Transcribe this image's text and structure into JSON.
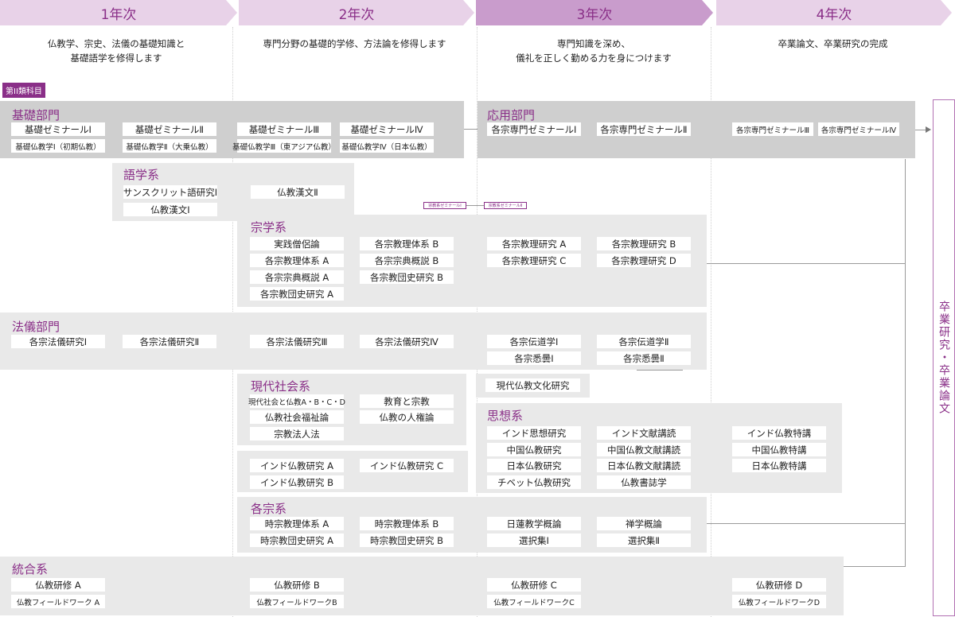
{
  "years": [
    "1年次",
    "2年次",
    "3年次",
    "4年次"
  ],
  "descriptions": {
    "y1": [
      "仏教学、宗史、法儀の基礎知識と",
      "基礎語学を修得します"
    ],
    "y2": [
      "専門分野の基礎的学修、方法論を修得します"
    ],
    "y3": [
      "専門知識を深め、",
      "儀礼を正しく勤める力を身につけます"
    ],
    "y4": [
      "卒業論文、卒業研究の完成"
    ]
  },
  "category_tag": "第II類科目",
  "kiso": {
    "title": "基礎部門",
    "courses": [
      "基礎ゼミナールⅠ",
      "基礎ゼミナールⅡ",
      "基礎ゼミナールⅢ",
      "基礎ゼミナールⅣ",
      "基礎仏教学Ⅰ（初期仏教）",
      "基礎仏教学Ⅱ（大乗仏教）",
      "基礎仏教学Ⅲ（東アジア仏教）",
      "基礎仏教学Ⅳ（日本仏教）"
    ]
  },
  "oyo": {
    "title": "応用部門",
    "courses": [
      "各宗専門ゼミナールⅠ",
      "各宗専門ゼミナールⅡ",
      "各宗専門ゼミナールⅢ",
      "各宗専門ゼミナールⅣ"
    ]
  },
  "gogaku": {
    "title": "語学系",
    "courses": [
      "サンスクリット語研究Ⅰ",
      "仏教漢文Ⅱ",
      "仏教漢文Ⅰ"
    ]
  },
  "mini_seminars": [
    "宗教系ゼミナールⅠ",
    "宗教系ゼミナールⅡ"
  ],
  "shugaku": {
    "title": "宗学系",
    "courses": [
      "実践僧侶論",
      "各宗教理体系 B",
      "各宗教理体系 A",
      "各宗宗典概説 B",
      "各宗宗典概説 A",
      "各宗教団史研究 B",
      "各宗教団史研究 A",
      "各宗教理研究 A",
      "各宗教理研究 B",
      "各宗教理研究 C",
      "各宗教理研究 D"
    ]
  },
  "hogi": {
    "title": "法儀部門",
    "courses": [
      "各宗法儀研究Ⅰ",
      "各宗法儀研究Ⅱ",
      "各宗法儀研究Ⅲ",
      "各宗法儀研究Ⅳ",
      "各宗伝道学Ⅰ",
      "各宗伝道学Ⅱ",
      "各宗悉曇Ⅰ",
      "各宗悉曇Ⅱ"
    ]
  },
  "gendai": {
    "title": "現代社会系",
    "courses": [
      "現代社会と仏教A・B・C・D",
      "教育と宗教",
      "仏教社会福祉論",
      "仏教の人権論",
      "宗教法人法",
      "現代仏教文化研究"
    ]
  },
  "shiso": {
    "title": "思想系",
    "courses": [
      "インド思想研究",
      "インド文献講読",
      "インド仏教特講",
      "中国仏教研究",
      "中国仏教文献講読",
      "中国仏教特講",
      "日本仏教研究",
      "日本仏教文献講読",
      "日本仏教特講",
      "チベット仏教研究",
      "仏教書誌学"
    ]
  },
  "indo": {
    "courses": [
      "インド仏教研究 A",
      "インド仏教研究 C",
      "インド仏教研究 B"
    ]
  },
  "kakushu": {
    "title": "各宗系",
    "courses": [
      "時宗教理体系 A",
      "時宗教理体系 B",
      "時宗教団史研究 A",
      "時宗教団史研究 B",
      "日蓮教学概論",
      "禅学概論",
      "選択集Ⅰ",
      "選択集Ⅱ"
    ]
  },
  "togo": {
    "title": "統合系",
    "courses": [
      "仏教研修 A",
      "仏教研修 B",
      "仏教研修 C",
      "仏教研修 D",
      "仏教フィールドワーク A",
      "仏教フィールドワークB",
      "仏教フィールドワークC",
      "仏教フィールドワークD"
    ]
  },
  "graduation": "卒業研究・卒業論文",
  "colors": {
    "accent": "#8a2f88",
    "year_light": "#e8d2e8",
    "year_dark": "#c99ccc",
    "panel_dark": "#cfcfcf",
    "panel_light": "#e9e9e9"
  }
}
